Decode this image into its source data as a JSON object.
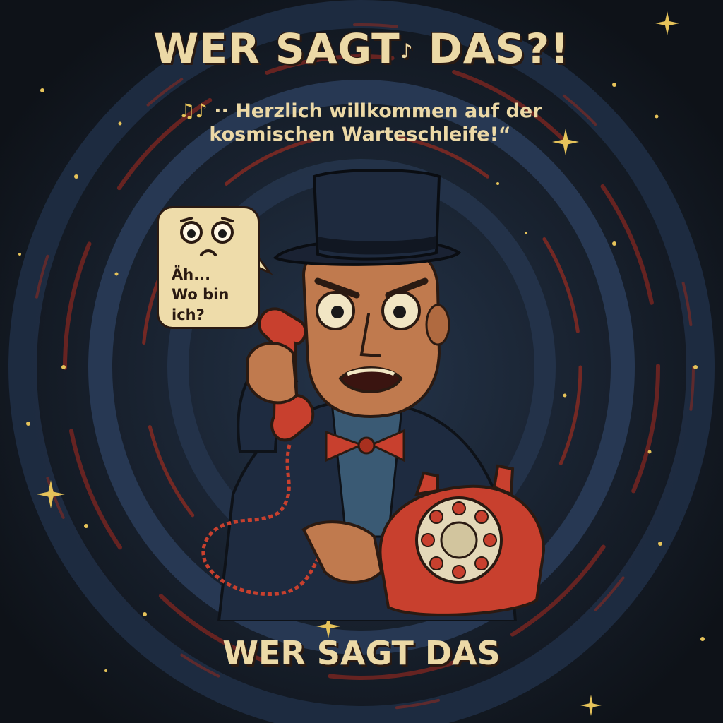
{
  "title": "WER SAGT DAS?!",
  "title_parts": [
    "WER SAGT",
    "DAS?!"
  ],
  "title_note_glyph": "♪",
  "subtitle": {
    "notes": "♫♪",
    "line1": "·· Herzlich willkommen auf der",
    "line2": "kosmischen Warteschleife!“"
  },
  "speech_bubble": {
    "line1": "Äh...",
    "line2": "Wo bin ich?",
    "face_icon": "worried-face-icon"
  },
  "bottom_title": "WER SAGT DAS",
  "illustration": {
    "subject": "man-in-top-hat-with-telephone",
    "icons": [
      "top-hat-icon",
      "telephone-handset-icon",
      "rotary-phone-icon",
      "bow-tie-icon",
      "sparkle-star-icon"
    ]
  },
  "colors": {
    "background": "#141a22",
    "swirl_blue": "#243650",
    "swirl_red": "#8a2a22",
    "cream_text": "#ecd9a6",
    "phone_red": "#c8402e",
    "skin": "#c07a4e",
    "star_gold": "#e6c35a"
  }
}
